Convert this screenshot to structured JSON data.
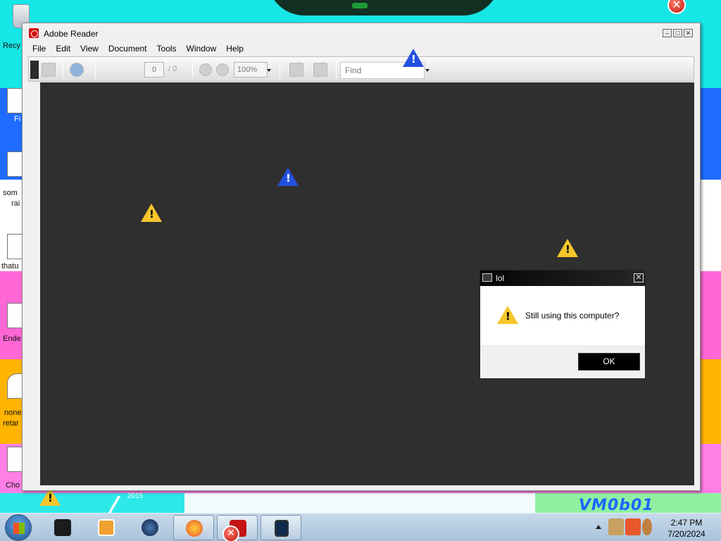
{
  "desktop": {
    "icon_labels": [
      "Recy",
      "Fi",
      "som",
      "rai",
      "thatu",
      "Ende",
      "none",
      "retar",
      "Cho"
    ],
    "watermark": "VM0b01",
    "year_text": "2015"
  },
  "reader": {
    "title": "Adobe Reader",
    "window_controls": [
      "minimize",
      "maximize",
      "close"
    ],
    "menu": [
      "File",
      "Edit",
      "View",
      "Document",
      "Tools",
      "Window",
      "Help"
    ],
    "toolbar": {
      "page_current": "0",
      "page_total": "/ 0",
      "zoom": "100%",
      "find_placeholder": "Find"
    }
  },
  "dialog": {
    "title": "lol",
    "message": "Still using this computer?",
    "ok_label": "OK"
  },
  "taskbar": {
    "apps": [
      "terminal-icon",
      "media-player-icon",
      "globe-icon",
      "firefox-icon",
      "adobe-reader-icon",
      "phone-icon"
    ],
    "clock_time": "2:47 PM",
    "clock_date": "7/20/2024"
  },
  "colors": {
    "doc_background": "#2f2f2f",
    "warning_yellow": "#f6c62c",
    "warning_blue": "#2450e0",
    "dialog_title": "#050505"
  }
}
